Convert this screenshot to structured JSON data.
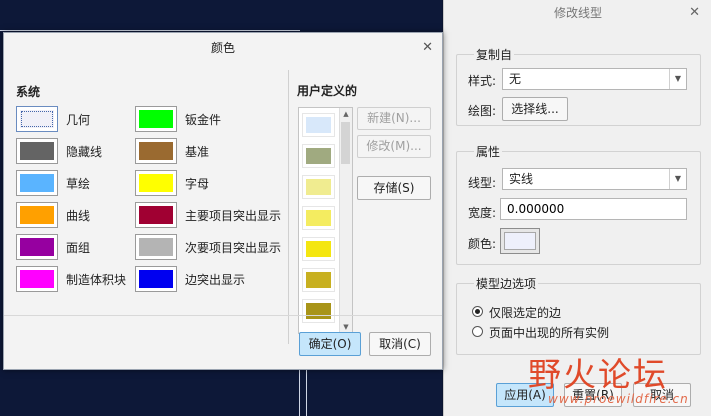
{
  "panel": {
    "title": "修改线型",
    "copy_from": {
      "group_title": "复制自",
      "style_label": "样式:",
      "style_value": "无",
      "draw_label": "绘图:",
      "select_line_button": "选择线..."
    },
    "attributes": {
      "group_title": "属性",
      "linetype_label": "线型:",
      "linetype_value": "实线",
      "width_label": "宽度:",
      "width_value": "0.000000",
      "color_label": "颜色:"
    },
    "model_edges": {
      "group_title": "模型边选项",
      "option_selected": "仅限选定的边",
      "option_all": "页面中出现的所有实例"
    },
    "apply_button": "应用(A)",
    "reset_button": "重置(R)",
    "cancel_button": "取消"
  },
  "color_dialog": {
    "title": "颜色",
    "system_title": "系统",
    "user_title": "用户定义的",
    "system_colors": [
      {
        "label": "几何",
        "color": "#f0f0f8"
      },
      {
        "label": "隐藏线",
        "color": "#646464"
      },
      {
        "label": "草绘",
        "color": "#5ab4ff"
      },
      {
        "label": "曲线",
        "color": "#ffa000"
      },
      {
        "label": "面组",
        "color": "#9600a0"
      },
      {
        "label": "制造体积块",
        "color": "#ff00ff"
      },
      {
        "label": "钣金件",
        "color": "#00ff00"
      },
      {
        "label": "基准",
        "color": "#9a6a30"
      },
      {
        "label": "字母",
        "color": "#ffff00"
      },
      {
        "label": "主要项目突出显示",
        "color": "#a00032"
      },
      {
        "label": "次要项目突出显示",
        "color": "#b4b4b4"
      },
      {
        "label": "边突出显示",
        "color": "#0000f0"
      }
    ],
    "user_colors": [
      "#d8e8fa",
      "#a0aa80",
      "#f0ec90",
      "#f4ec60",
      "#f4e610",
      "#c8b020",
      "#a89418"
    ],
    "new_button": "新建(N)...",
    "modify_button": "修改(M)...",
    "save_button": "存储(S)",
    "ok_button": "确定(O)",
    "cancel_button": "取消(C)"
  },
  "watermark": {
    "logo": "野火论坛",
    "url": "www.proewildfire.cn"
  }
}
